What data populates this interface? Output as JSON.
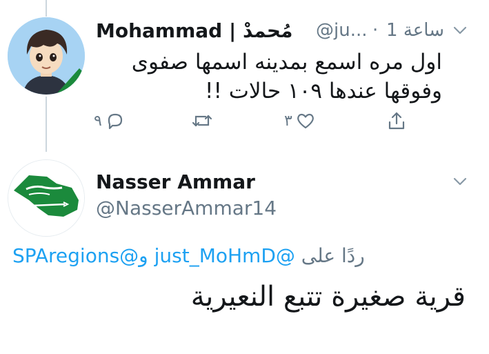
{
  "tweet1": {
    "display_name": "Mohammad | مُحمدْ",
    "handle": "@ju...",
    "separator": "·",
    "time": "1 ساعة",
    "line1": "اول مره اسمع بمدينه اسمها صفوى",
    "line2": "وفوقها عندها ١٠٩ حالات !!",
    "reply_count": "٩",
    "like_count": "٣",
    "icons": [
      "reply-icon",
      "retweet-icon",
      "like-icon",
      "share-icon",
      "chevron-down-icon"
    ]
  },
  "tweet2": {
    "display_name": "Nasser Ammar",
    "handle": "@NasserAmmar14",
    "replying_prefix": "ردًا على",
    "mention1": "@just_MoHmD",
    "conjunction": "و",
    "mention2": "@SPAregions",
    "body": "قرية صغيرة تتبع النعيرية"
  },
  "colors": {
    "accent": "#1da1f2",
    "muted": "#657786",
    "text": "#14171a",
    "avatar_bg": "#a7d3f3",
    "flag_green": "#1b8a3c"
  }
}
